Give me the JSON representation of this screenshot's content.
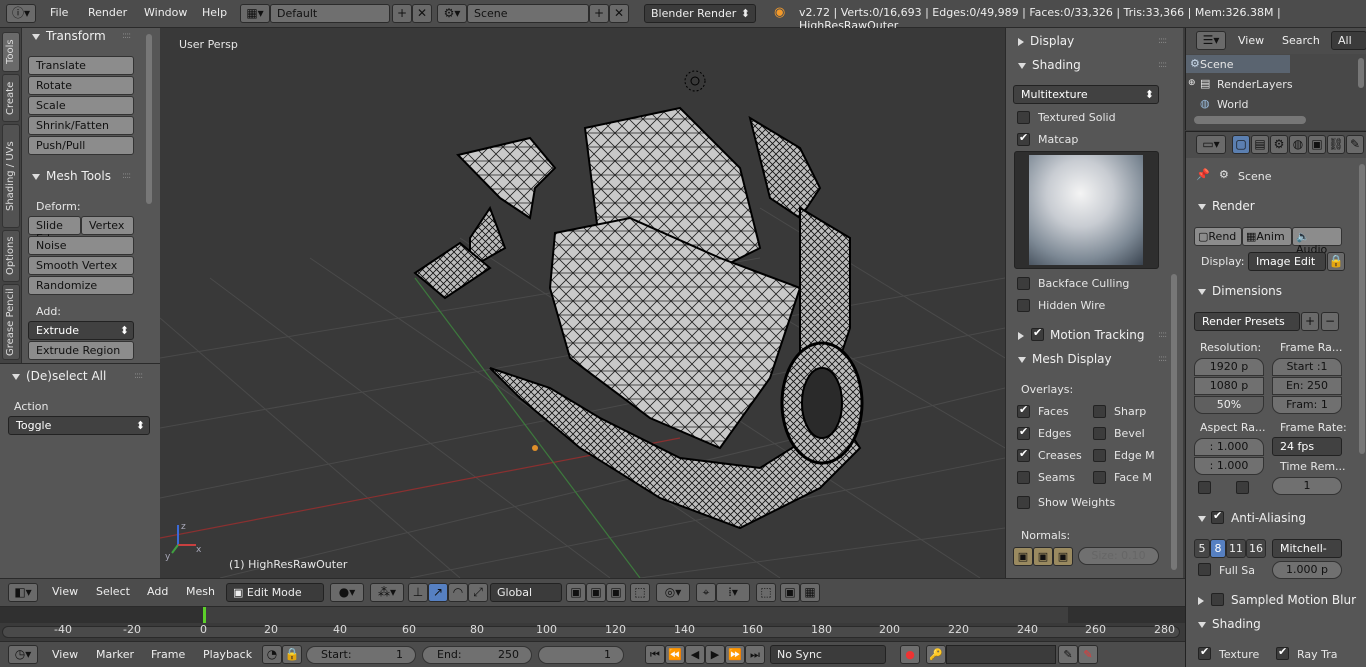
{
  "topbar": {
    "menus": [
      "File",
      "Render",
      "Window",
      "Help"
    ],
    "layout": "Default",
    "scene": "Scene",
    "engine": "Blender Render",
    "stats": "v2.72 | Verts:0/16,693 | Edges:0/49,989 | Faces:0/33,326 | Tris:33,366 | Mem:326.38M | HighResRawOuter"
  },
  "tabs": [
    "Tools",
    "Create",
    "Shading / UVs",
    "Options",
    "Grease Pencil"
  ],
  "toolshelf": {
    "transform": {
      "title": "Transform",
      "buttons": [
        "Translate",
        "Rotate",
        "Scale",
        "Shrink/Fatten",
        "Push/Pull"
      ]
    },
    "meshtools": {
      "title": "Mesh Tools",
      "deform_label": "Deform:",
      "slide_edge": "Slide Ed",
      "vertex": "Vertex",
      "noise": "Noise",
      "smooth": "Smooth Vertex",
      "randomize": "Randomize",
      "add_label": "Add:",
      "extrude": "Extrude",
      "extrude_region": "Extrude Region"
    }
  },
  "operator": {
    "title": "(De)select All",
    "action_label": "Action",
    "action_value": "Toggle"
  },
  "viewport": {
    "label": "User Persp",
    "object": "(1) HighResRawOuter"
  },
  "npanel": {
    "display": "Display",
    "shading": "Shading",
    "shading_mode": "Multitexture",
    "textured_solid": "Textured Solid",
    "matcap": "Matcap",
    "backface": "Backface Culling",
    "hidden_wire": "Hidden Wire",
    "motion_tracking": "Motion Tracking",
    "mesh_display": "Mesh Display",
    "overlays": "Overlays:",
    "faces": "Faces",
    "sharp": "Sharp",
    "edges": "Edges",
    "bevel": "Bevel",
    "creases": "Creases",
    "edge_m": "Edge M",
    "seams": "Seams",
    "face_m": "Face M",
    "show_weights": "Show Weights",
    "normals": "Normals:",
    "size": "Size:  0.10"
  },
  "outliner": {
    "view": "View",
    "search": "Search",
    "all": "All Sc",
    "items": [
      "Scene",
      "RenderLayers",
      "World"
    ]
  },
  "props": {
    "scene": "Scene",
    "render": "Render",
    "rend": "Rend",
    "anim": "Anim",
    "audio": "Audio",
    "display_label": "Display:",
    "display_value": "Image Edit",
    "dimensions": "Dimensions",
    "presets": "Render Presets",
    "resolution": "Resolution:",
    "res_x": "1920 p",
    "res_y": "1080 p",
    "res_pct": "50%",
    "frame_range": "Frame Ra...",
    "start": "Start :1",
    "end": "En: 250",
    "frame": "Fram: 1",
    "aspect": "Aspect Ra...",
    "asp_x": ": 1.000",
    "asp_y": ": 1.000",
    "frame_rate": "Frame Rate:",
    "fps": "24 fps",
    "time_remap": "Time Rem...",
    "remap_val": "1",
    "aa": "Anti-Aliasing",
    "aa_5": "5",
    "aa_8": "8",
    "aa_11": "11",
    "aa_16": "16",
    "filter": "Mitchell-N",
    "full_sample": "Full Sa",
    "filter_size": "1.000 p",
    "motion_blur": "Sampled Motion Blur",
    "shading": "Shading",
    "texture": "Texture",
    "raytrace": "Ray Tra"
  },
  "vheader": {
    "view": "View",
    "select": "Select",
    "add": "Add",
    "mesh": "Mesh",
    "mode": "Edit Mode",
    "orientation": "Global"
  },
  "timeline": {
    "ticks": [
      "-40",
      "-20",
      "0",
      "20",
      "40",
      "60",
      "80",
      "100",
      "120",
      "140",
      "160",
      "180",
      "200",
      "220",
      "240",
      "260",
      "280"
    ]
  },
  "tlheader": {
    "view": "View",
    "marker": "Marker",
    "frame": "Frame",
    "playback": "Playback",
    "start": "Start:",
    "start_val": "1",
    "end": "End:",
    "end_val": "250",
    "current": "1",
    "sync": "No Sync"
  }
}
